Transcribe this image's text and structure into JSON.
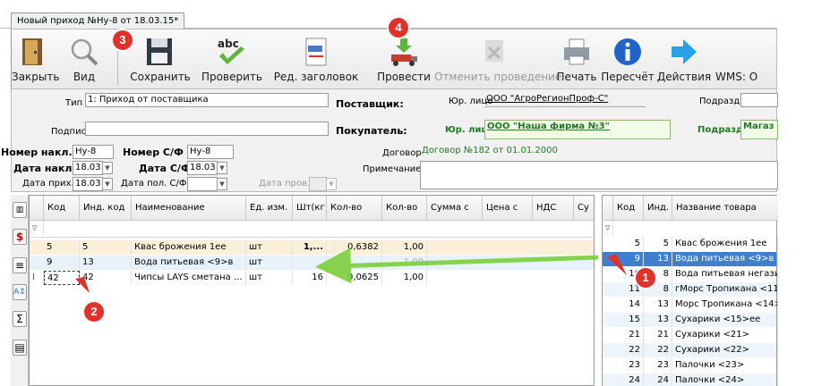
{
  "window": {
    "tab_title": "Новый приход №Ну-8 от 18.03.15*"
  },
  "toolbar": {
    "close": "Закрыть",
    "view": "Вид",
    "save": "Сохранить",
    "check": "Проверить",
    "edit_header": "Ред. заголовок",
    "post": "Провести",
    "unpost": "Отменить проведение",
    "print": "Печать",
    "recalc": "Пересчёт",
    "actions": "Действия",
    "wms": "WMS: O",
    "abc_text": "abc"
  },
  "badges": {
    "b1": "1",
    "b2": "2",
    "b3": "3",
    "b4": "4"
  },
  "header": {
    "type_label": "Тип",
    "type_value": "1: Приход от поставщика",
    "signer_label": "Подпис",
    "signer_value": "",
    "supplier_label": "Поставщик:",
    "supplier_legal_label": "Юр. лицо",
    "supplier_legal_value": "ООО \"АгроРегионПроф-С\"",
    "buyer_label": "Покупатель:",
    "buyer_legal_label": "Юр. лицо",
    "buyer_legal_value": "ООО \"Наша фирма №3\"",
    "dept_label": "Подразд.",
    "dept_value": "",
    "buyer_dept_label": "Подразд.",
    "buyer_dept_value": "Магаз",
    "invoice_no_label": "Номер накл.",
    "invoice_no_value": "Ну-8",
    "sf_no_label": "Номер С/Ф",
    "sf_no_value": "Ну-8",
    "invoice_date_label": "Дата накл.",
    "invoice_date_value": "18.03",
    "sf_date_label": "Дата С/Ф",
    "sf_date_value": "18.03",
    "arrival_date_label": "Дата прих.",
    "arrival_date_value": "18.03",
    "sf_recv_label": "Дата пол. С/Ф",
    "sf_recv_value": "",
    "check_date_label": "Дата пров.",
    "check_date_value": "",
    "contract_label": "Договор",
    "contract_value": "Договор №182 от 01.01.2000",
    "note_label": "Примечание",
    "note_value": ""
  },
  "grid": {
    "columns": [
      "Код",
      "Инд. код",
      "Наименование",
      "Ед. изм.",
      "Шт(кг)",
      "Кол-во",
      "Кол-во",
      "Сумма с",
      "Цена с",
      "НДС",
      "Су"
    ],
    "filter_mark": "∇",
    "rows": [
      {
        "code": "5",
        "ind": "5",
        "name": "Квас брожения 1ее",
        "unit": "шт",
        "pcs": "1,...",
        "qty1": "0,6382",
        "qty2": "1,00"
      },
      {
        "code": "9",
        "ind": "13",
        "name": "Вода питьевая  <9>в",
        "unit": "шт",
        "pcs": "",
        "qty1": "",
        "qty2": "1,00"
      },
      {
        "code": "42",
        "ind": "42",
        "name": "Чипсы LAYS сметана ...",
        "unit": "шт",
        "pcs": "16",
        "qty1": "0,0625",
        "qty2": "1,00"
      }
    ],
    "row_marker": "I"
  },
  "catalog": {
    "columns": [
      "Код",
      "Инд.",
      "Название товара"
    ],
    "filter_mark": "∇",
    "rows": [
      {
        "code": "5",
        "ind": "5",
        "name": "Квас брожения 1ее"
      },
      {
        "code": "9",
        "ind": "13",
        "name": "Вода питьевая  <9>в"
      },
      {
        "code": "10",
        "ind": "8",
        "name": "Вода питьевая негази..."
      },
      {
        "code": "11",
        "ind": "8",
        "name": "гМорс Тропикана  <11"
      },
      {
        "code": "14",
        "ind": "13",
        "name": "Морс Тропикана  <14>"
      },
      {
        "code": "15",
        "ind": "13",
        "name": "Сухарики  <15>ее"
      },
      {
        "code": "21",
        "ind": "21",
        "name": "Сухарики  <21>"
      },
      {
        "code": "22",
        "ind": "22",
        "name": "Сухарики  <22>"
      },
      {
        "code": "23",
        "ind": "23",
        "name": "Палочки  <23>"
      },
      {
        "code": "24",
        "ind": "24",
        "name": "Палочки  <24>"
      }
    ]
  },
  "sidebar": {
    "dollar": "$",
    "sigma": "Σ"
  },
  "colors": {
    "accent_selected": "#3f7fd0",
    "badge": "#e0322a",
    "arrow": "#7ccf3a"
  }
}
